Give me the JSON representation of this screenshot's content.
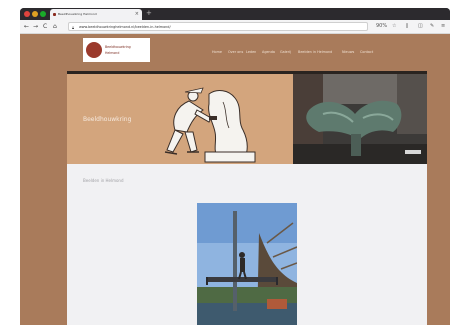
{
  "browser": {
    "tab_title": "Beeldhouwkring Helmond",
    "new_tab": "+",
    "tab_close": "×",
    "url": "www.beeldhouwkringhelmond.nl/beelden-in-helmond/",
    "nav_back": "←",
    "nav_forward": "→",
    "nav_reload": "C",
    "nav_home": "⌂",
    "zoom": "90%",
    "window_controls": [
      "#e0443e",
      "#dea123",
      "#1aab29"
    ]
  },
  "site": {
    "logo_line1": "Beeldhouwkring",
    "logo_line2": "Helmond",
    "menu": [
      "Home",
      "Over ons",
      "Leden",
      "Agenda",
      "Galerij",
      "Beelden in Helmond",
      "Nieuws",
      "Contact"
    ],
    "hero_title": "Beeldhouwkring",
    "section_title": "Beelden in Helmond"
  },
  "colors": {
    "page_bg": "#a97b5b",
    "hero_left": "#d3a57d",
    "content_bg": "#f1f1f3",
    "brand": "#9b3a2c"
  }
}
